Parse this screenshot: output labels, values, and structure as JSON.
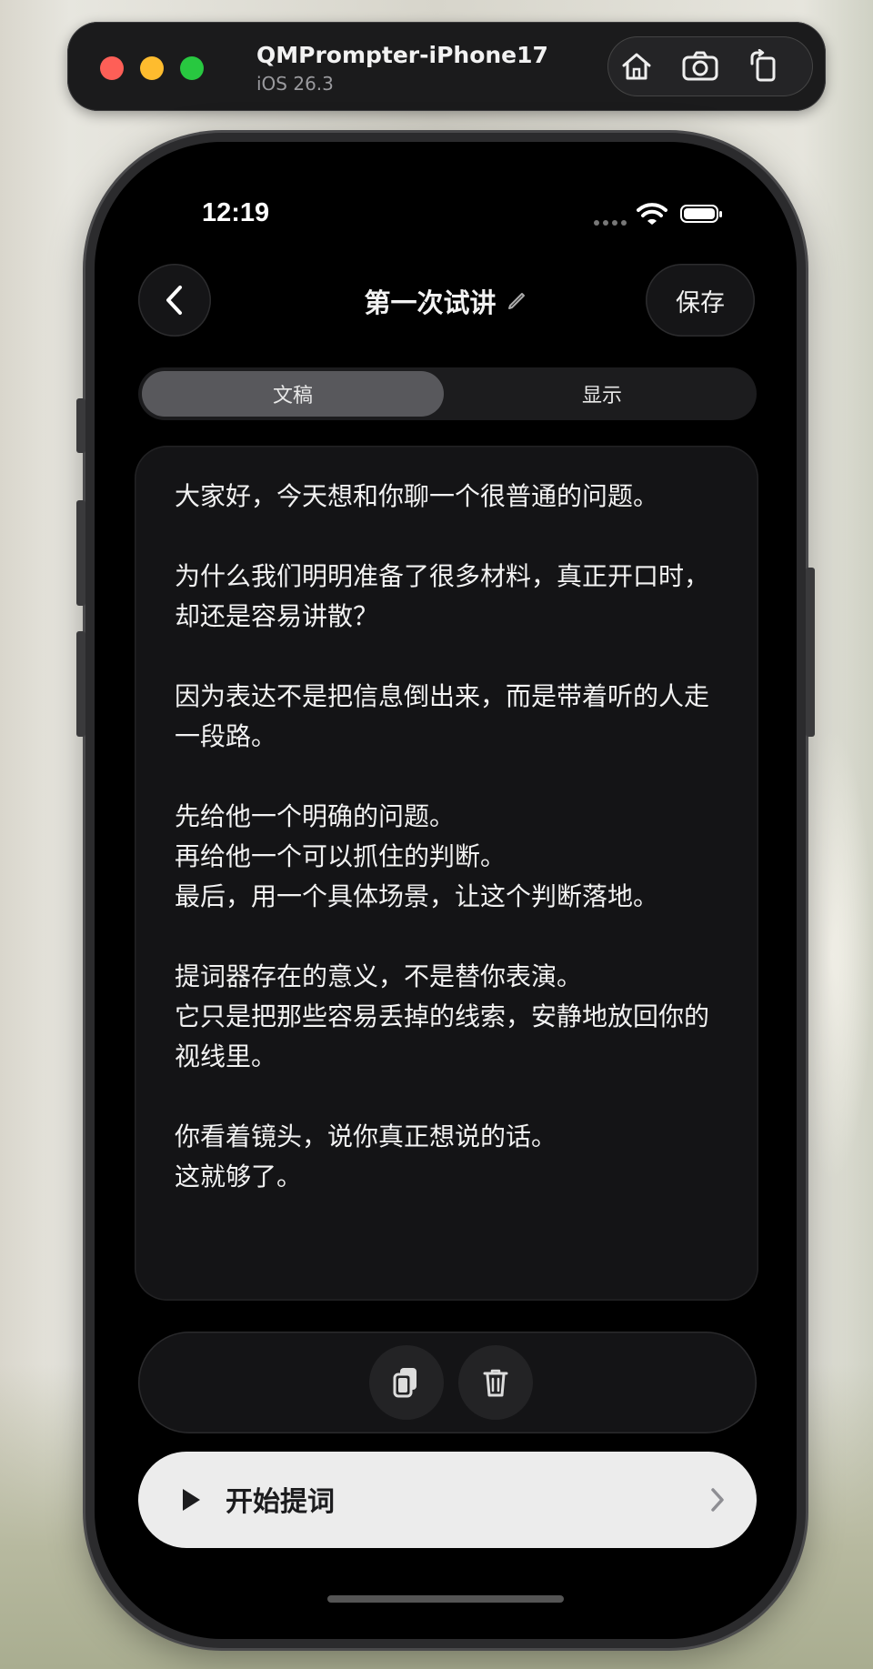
{
  "simulator": {
    "device_name": "QMPrompter-iPhone17",
    "os_version": "iOS 26.3",
    "actions": [
      "home-icon",
      "screenshot-icon",
      "rotate-icon"
    ]
  },
  "status_bar": {
    "time": "12:19"
  },
  "nav": {
    "title": "第一次试讲",
    "save_label": "保存"
  },
  "segmented": {
    "tabs": [
      {
        "label": "文稿",
        "selected": true
      },
      {
        "label": "显示",
        "selected": false
      }
    ]
  },
  "editor": {
    "content": "大家好，今天想和你聊一个很普通的问题。\n\n为什么我们明明准备了很多材料，真正开口时，却还是容易讲散？\n\n因为表达不是把信息倒出来，而是带着听的人走一段路。\n\n先给他一个明确的问题。\n再给他一个可以抓住的判断。\n最后，用一个具体场景，让这个判断落地。\n\n提词器存在的意义，不是替你表演。\n它只是把那些容易丢掉的线索，安静地放回你的视线里。\n\n你看着镜头，说你真正想说的话。\n这就够了。"
  },
  "actions": {
    "buttons": [
      "copy-icon",
      "trash-icon"
    ]
  },
  "start_button": {
    "label": "开始提词"
  },
  "colors": {
    "screen_bg": "#000000",
    "card_bg": "#141416",
    "segment_active": "#58585c",
    "start_bg": "#ececec"
  }
}
